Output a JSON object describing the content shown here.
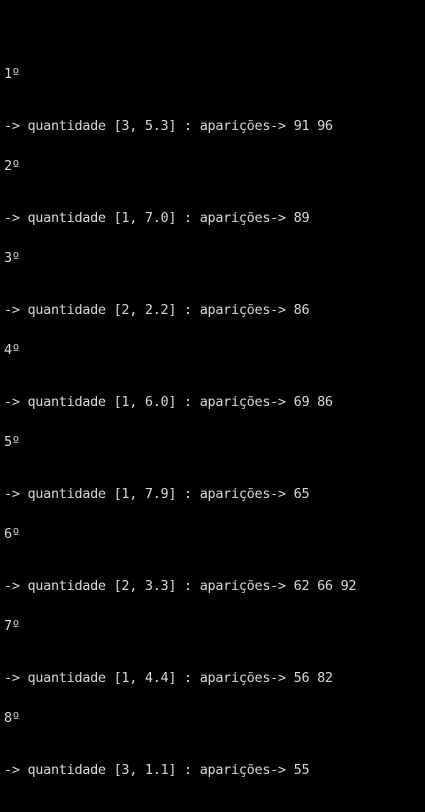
{
  "console": {
    "text_color": "#d8d8d8",
    "background": "#000000",
    "entries": [
      {
        "rank": "1º",
        "detail": "-> quantidade [3, 5.3] : aparições-> 91 96"
      },
      {
        "rank": "2º",
        "detail": "-> quantidade [1, 7.0] : aparições-> 89"
      },
      {
        "rank": "3º",
        "detail": "-> quantidade [2, 2.2] : aparições-> 86"
      },
      {
        "rank": "4º",
        "detail": "-> quantidade [1, 6.0] : aparições-> 69 86"
      },
      {
        "rank": "5º",
        "detail": "-> quantidade [1, 7.9] : aparições-> 65"
      },
      {
        "rank": "6º",
        "detail": "-> quantidade [2, 3.3] : aparições-> 62 66 92"
      },
      {
        "rank": "7º",
        "detail": "-> quantidade [1, 4.4] : aparições-> 56 82"
      },
      {
        "rank": "8º",
        "detail": "-> quantidade [3, 1.1] : aparições-> 55"
      }
    ]
  }
}
